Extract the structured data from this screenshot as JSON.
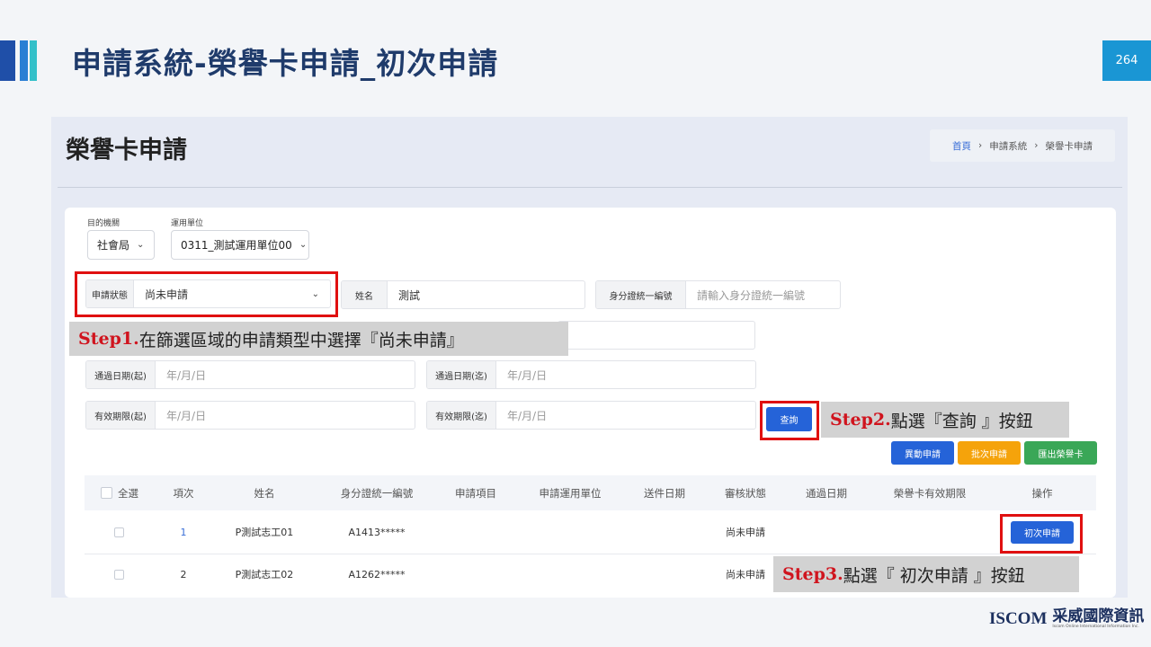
{
  "slide": {
    "title": "申請系統-榮譽卡申請_初次申請",
    "page_number": "264"
  },
  "app": {
    "page_title": "榮譽卡申請",
    "breadcrumb": [
      "首頁",
      "申請系統",
      "榮譽卡申請"
    ],
    "breadcrumb_sep": "›"
  },
  "filters": {
    "agency_label": "目的機關",
    "agency_value": "社會局",
    "unit_label": "運用單位",
    "unit_value": "0311_測試運用單位00",
    "status_label": "申請狀態",
    "status_value": "尚未申請",
    "name_label": "姓名",
    "name_value": "測試",
    "id_label": "身分證統一編號",
    "id_placeholder": "請輸入身分證統一編號",
    "pass_start_label": "通過日期(起)",
    "pass_end_label": "通過日期(迄)",
    "valid_start_label": "有效期限(起)",
    "valid_end_label": "有效期限(迄)",
    "date_placeholder": "年/月/日",
    "search_button": "查詢"
  },
  "actions": {
    "change_apply": "異動申請",
    "batch_apply": "批次申請",
    "export_card": "匯出榮譽卡"
  },
  "table": {
    "columns": [
      "全選",
      "項次",
      "姓名",
      "身分證統一編號",
      "申請項目",
      "申請運用單位",
      "送件日期",
      "審核狀態",
      "通過日期",
      "榮譽卡有效期限",
      "操作"
    ],
    "rows": [
      {
        "index": "1",
        "name": "P測試志工01",
        "id": "A1413*****",
        "status": "尚未申請",
        "action": "初次申請"
      },
      {
        "index": "2",
        "name": "P測試志工02",
        "id": "A1262*****",
        "status": "尚未申請",
        "action": ""
      }
    ]
  },
  "callouts": {
    "step1_num": "Step1.",
    "step1_text": "在篩選區域的申請類型中選擇『尚未申請』",
    "step2_num": "Step2.",
    "step2_text": "點選『查詢 』按鈕",
    "step3_num": "Step3.",
    "step3_text": "點選『 初次申請 』按鈕"
  },
  "logo": {
    "brand": "ISCOM",
    "chinese": "采威國際資訊",
    "english": "Iscom Online International Information Inc."
  },
  "colors": {
    "accent_blue": "#2563d8",
    "orange": "#f5a30b",
    "green": "#3aa757",
    "highlight_red": "#e01010",
    "slide_title": "#1f3b6b"
  }
}
